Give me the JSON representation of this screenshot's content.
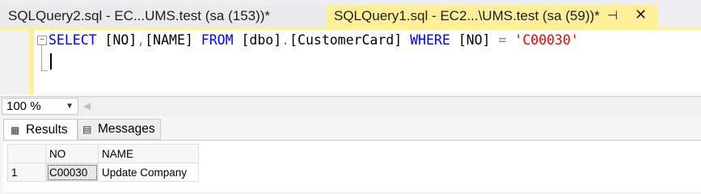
{
  "tabs": [
    {
      "label": "SQLQuery2.sql - EC...UMS.test (sa (153))*"
    },
    {
      "label": "SQLQuery1.sql - EC2...\\UMS.test (sa (59))*",
      "pin": "⊣",
      "close": "✕"
    }
  ],
  "editor": {
    "tokens": {
      "select": "SELECT",
      "col1": "[NO]",
      "comma": ",",
      "col2": "[NAME]",
      "from": "FROM",
      "schema": "[dbo]",
      "dot": ".",
      "table": "[CustomerCard]",
      "where": "WHERE",
      "col3": "[NO]",
      "equals": "=",
      "value": "'C00030'"
    },
    "collapse_glyph": "−"
  },
  "zoom": {
    "value": "100 %"
  },
  "results": {
    "tabs": [
      {
        "label": "Results",
        "icon": "grid-icon"
      },
      {
        "label": "Messages",
        "icon": "messages-icon"
      }
    ],
    "columns": [
      "NO",
      "NAME"
    ],
    "rows": [
      {
        "rownum": "1",
        "cells": [
          "C00030",
          "Update Company"
        ]
      }
    ]
  },
  "colors": {
    "active_tab": "#ffef98",
    "keyword": "#0000ff",
    "string": "#ff0000"
  }
}
